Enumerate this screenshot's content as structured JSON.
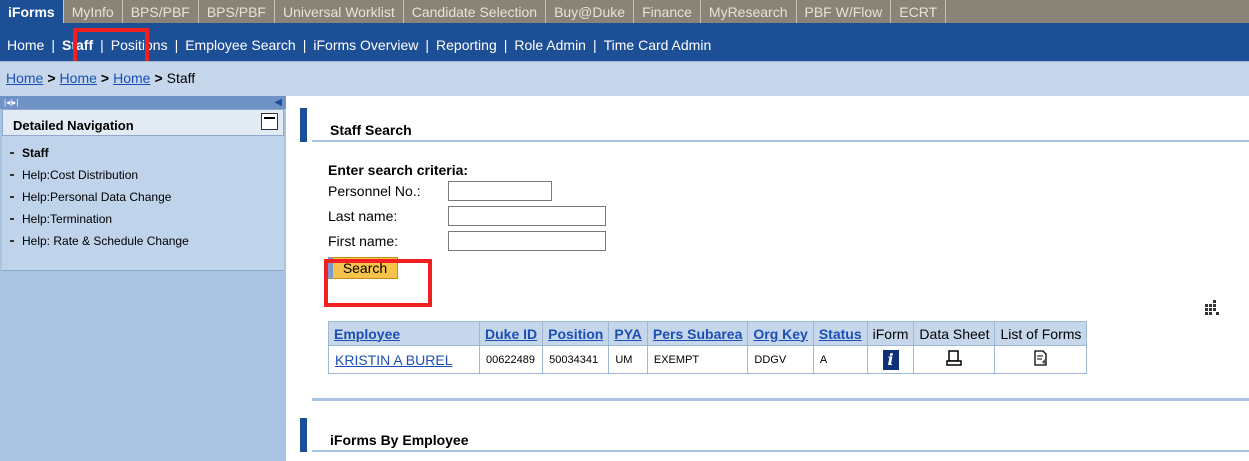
{
  "top_tabs": [
    "iForms",
    "MyInfo",
    "BPS/PBF",
    "BPS/PBF",
    "Universal Worklist",
    "Candidate Selection",
    "Buy@Duke",
    "Finance",
    "MyResearch",
    "PBF W/Flow",
    "ECRT"
  ],
  "sub_nav": [
    "Home",
    "Staff",
    "Positions",
    "Employee Search",
    "iForms Overview",
    "Reporting",
    "Role Admin",
    "Time Card Admin"
  ],
  "breadcrumb": {
    "links": [
      "Home",
      "Home",
      "Home"
    ],
    "current": "Staff",
    "arrow": ">"
  },
  "left_panel": {
    "header": "Detailed Navigation",
    "items": [
      "Staff",
      "Help:Cost Distribution",
      "Help:Personal Data Change",
      "Help:Termination",
      "Help: Rate & Schedule Change"
    ]
  },
  "staff_search": {
    "title": "Staff Search",
    "prompt": "Enter search criteria:",
    "fields": [
      {
        "label": "Personnel No.:",
        "value": ""
      },
      {
        "label": "Last name:",
        "value": ""
      },
      {
        "label": "First name:",
        "value": ""
      }
    ],
    "search_label": "Search"
  },
  "results": {
    "headers": [
      "Employee",
      "Duke ID",
      "Position",
      "PYA",
      "Pers Subarea",
      "Org Key",
      "Status",
      "iForm",
      "Data Sheet",
      "List of Forms"
    ],
    "rows": [
      {
        "employee": "KRISTIN A BUREL",
        "duke_id": "00622489",
        "position": "50034341",
        "pya": "UM",
        "pers_subarea": "EXEMPT",
        "org_key": "DDGV",
        "status": "A"
      }
    ]
  },
  "iforms_by_employee": {
    "title": "iForms By Employee"
  },
  "highlight_color": "#f02020",
  "icons": [
    "iform-icon",
    "data-sheet-icon",
    "list-of-forms-icon",
    "table-settings-icon"
  ]
}
